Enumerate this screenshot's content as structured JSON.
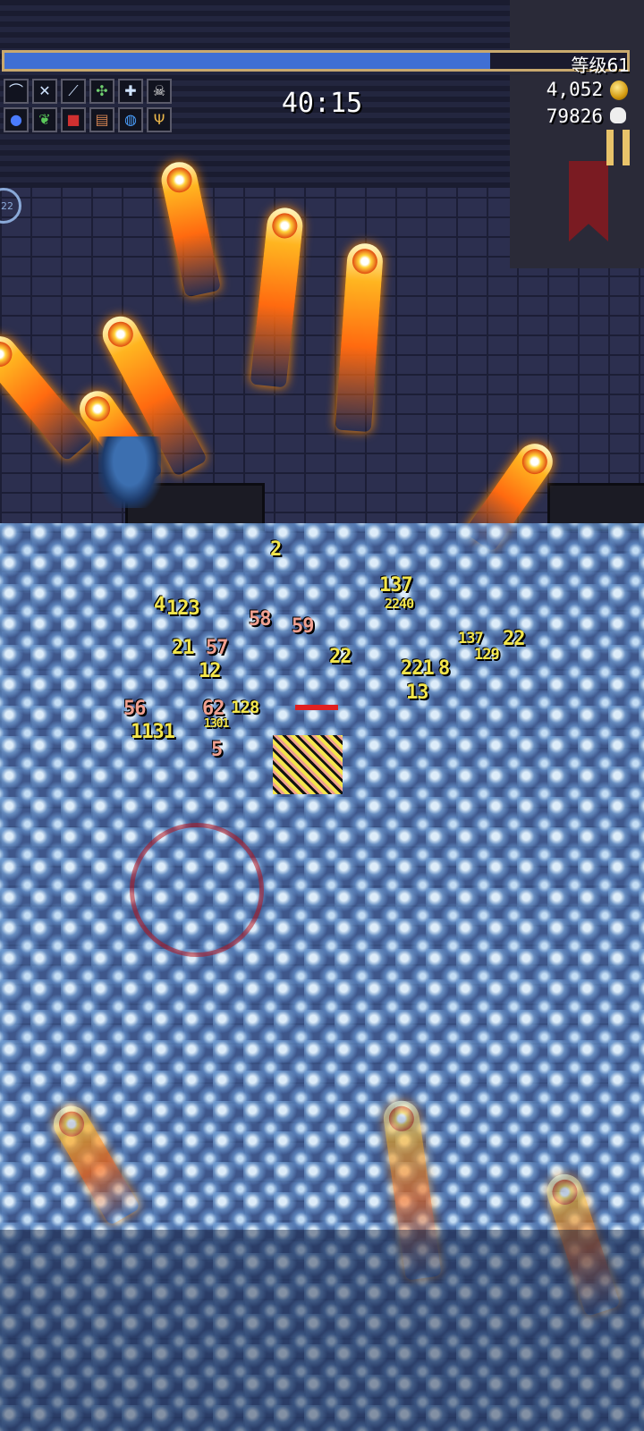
{
  "hud": {
    "level_label": "等级61",
    "xp_fraction": 0.78,
    "timer": "40:15",
    "gold": "4,052",
    "kills": "79826",
    "side_counter": "22"
  },
  "weapons": [
    {
      "icon": "whip-icon",
      "glyph": "⌒"
    },
    {
      "icon": "crossed-swords-icon",
      "glyph": "✕"
    },
    {
      "icon": "magic-wand-icon",
      "glyph": "⟋"
    },
    {
      "icon": "clover-icon",
      "glyph": "✣"
    },
    {
      "icon": "cross-icon",
      "glyph": "✚"
    },
    {
      "icon": "skull-weapon-icon",
      "glyph": "☠"
    }
  ],
  "passives": [
    {
      "icon": "orb-icon",
      "glyph": "●"
    },
    {
      "icon": "leaf-icon",
      "glyph": "❦"
    },
    {
      "icon": "armor-icon",
      "glyph": "■"
    },
    {
      "icon": "scroll-icon",
      "glyph": "▤"
    },
    {
      "icon": "ring-icon",
      "glyph": "◍"
    },
    {
      "icon": "trident-icon",
      "glyph": "Ψ"
    }
  ],
  "damage_numbers": [
    {
      "text": "2",
      "style": "yellow"
    },
    {
      "text": "4",
      "style": "yellow"
    },
    {
      "text": "123",
      "style": "yellow"
    },
    {
      "text": "58",
      "style": "red"
    },
    {
      "text": "59",
      "style": "red"
    },
    {
      "text": "21",
      "style": "yellow"
    },
    {
      "text": "57",
      "style": "red"
    },
    {
      "text": "12",
      "style": "yellow"
    },
    {
      "text": "22",
      "style": "yellow"
    },
    {
      "text": "137",
      "style": "yellow"
    },
    {
      "text": "2240",
      "style": "yellow"
    },
    {
      "text": "221",
      "style": "yellow"
    },
    {
      "text": "8",
      "style": "yellow"
    },
    {
      "text": "13",
      "style": "yellow"
    },
    {
      "text": "137",
      "style": "yellow"
    },
    {
      "text": "129",
      "style": "yellow"
    },
    {
      "text": "22",
      "style": "yellow"
    },
    {
      "text": "56",
      "style": "red"
    },
    {
      "text": "1131",
      "style": "yellow"
    },
    {
      "text": "62",
      "style": "red"
    },
    {
      "text": "128",
      "style": "yellow"
    },
    {
      "text": "1301",
      "style": "yellow"
    },
    {
      "text": "5",
      "style": "red"
    }
  ],
  "colors": {
    "xp_fill": "#3f6fd4",
    "xp_border": "#c9a96e",
    "damage_yellow": "#f3e64b",
    "damage_red": "#f0a090"
  }
}
